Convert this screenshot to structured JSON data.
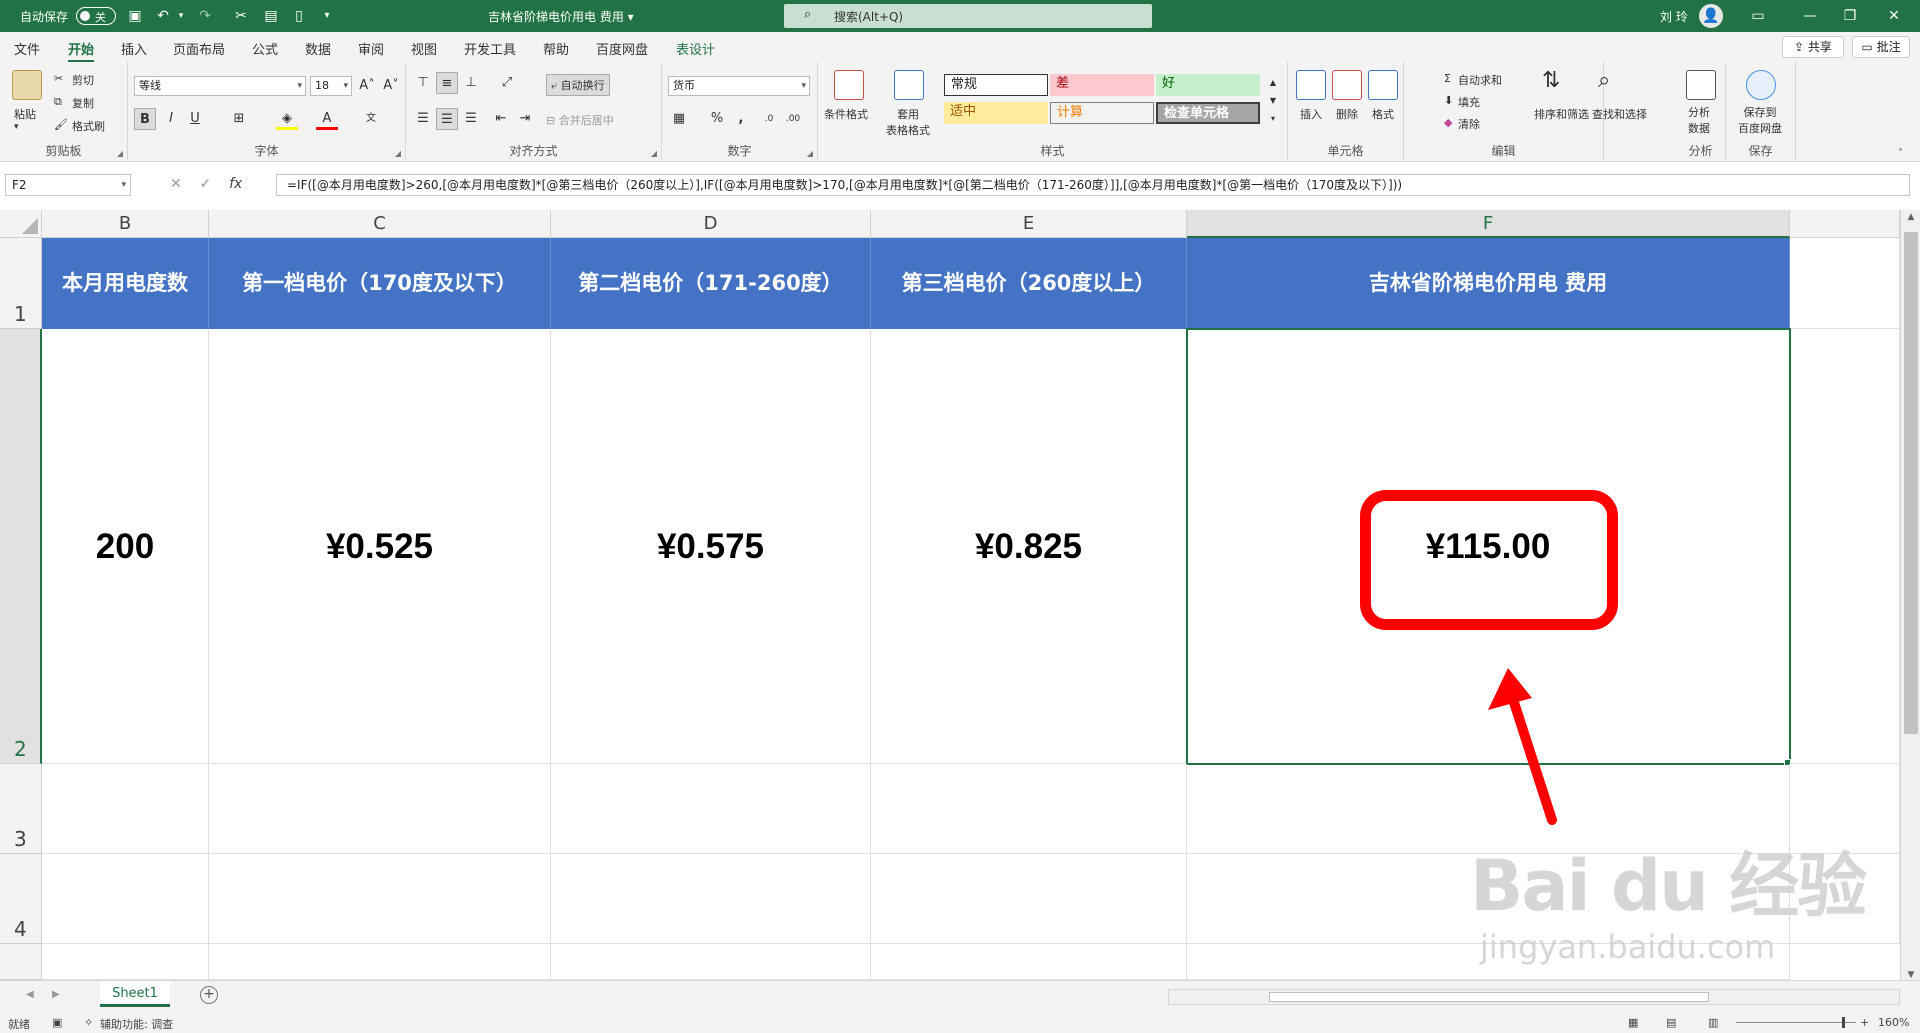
{
  "titlebar": {
    "autosave_label": "自动保存",
    "autosave_state": "关",
    "doc_title": "吉林省阶梯电价用电 费用 ▾",
    "search_placeholder": "搜索(Alt+Q)",
    "user_name": "刘 玲"
  },
  "menu": {
    "tabs": [
      "文件",
      "开始",
      "插入",
      "页面布局",
      "公式",
      "数据",
      "审阅",
      "视图",
      "开发工具",
      "帮助",
      "百度网盘",
      "表设计"
    ],
    "share_label": "共享",
    "comment_label": "批注"
  },
  "ribbon": {
    "clipboard": {
      "paste": "粘贴",
      "cut": "剪切",
      "copy": "复制",
      "format_painter": "格式刷",
      "label": "剪贴板"
    },
    "font": {
      "name": "等线",
      "size": "18",
      "label": "字体"
    },
    "alignment": {
      "wrap": "自动换行",
      "merge": "合并后居中",
      "label": "对齐方式"
    },
    "number": {
      "format": "货币",
      "label": "数字"
    },
    "styles": {
      "conditional": "条件格式",
      "table_format": "套用\n表格格式",
      "normal": "常规",
      "bad": "差",
      "good": "好",
      "neutral": "适中",
      "calc": "计算",
      "check": "检查单元格",
      "label": "样式"
    },
    "cells": {
      "insert": "插入",
      "delete": "删除",
      "format": "格式",
      "label": "单元格"
    },
    "editing": {
      "autosum": "自动求和",
      "fill": "填充",
      "clear": "清除",
      "sort": "排序和筛选",
      "find": "查找和选择",
      "label": "编辑"
    },
    "analysis": {
      "analyze": "分析\n数据",
      "label": "分析"
    },
    "save": {
      "save_baidu": "保存到\n百度网盘",
      "label": "保存"
    }
  },
  "formula_bar": {
    "name_box": "F2",
    "formula": "=IF([@本月用电度数]>260,[@本月用电度数]*[@第三档电价（260度以上）],IF([@本月用电度数]>170,[@本月用电度数]*[@[第二档电价（171-260度）]],[@本月用电度数]*[@第一档电价（170度及以下）]))"
  },
  "grid": {
    "columns": [
      "B",
      "C",
      "D",
      "E",
      "F"
    ],
    "rows": [
      "1",
      "2",
      "3",
      "4"
    ],
    "headers": [
      "本月用电度数",
      "第一档电价（170度及以下）",
      "第二档电价（171-260度）",
      "第三档电价（260度以上）",
      "吉林省阶梯电价用电 费用"
    ],
    "values": [
      "200",
      "¥0.525",
      "¥0.575",
      "¥0.825",
      "¥115.00"
    ]
  },
  "sheet": {
    "tab_name": "Sheet1"
  },
  "status": {
    "ready": "就绪",
    "accessibility": "辅助功能: 调查",
    "zoom": "160%"
  },
  "colors": {
    "excel_green": "#217346",
    "header_blue": "#4472c4",
    "highlight_red": "#ff0000"
  },
  "watermark": {
    "brand": "Bai du 经验",
    "url": "jingyan.baidu.com"
  }
}
